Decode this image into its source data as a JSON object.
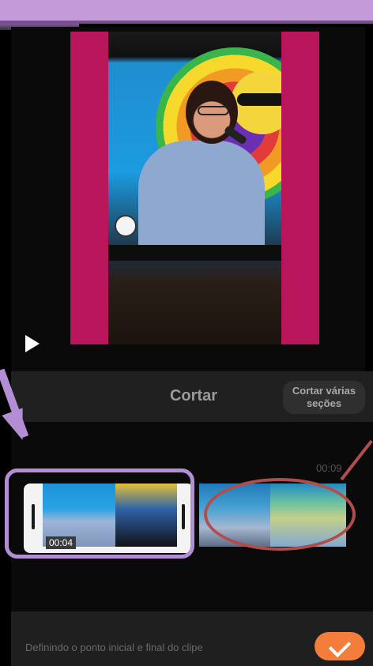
{
  "editor": {
    "title": "Cortar",
    "multi_button": "Cortar várias seções",
    "timeline": {
      "duration": "00:09",
      "selection_time": "00:04"
    },
    "hint": "Definindo o ponto inicial e final do clipe"
  },
  "colors": {
    "accent": "#f47d3b",
    "annotation_purple": "#b48ed4",
    "annotation_red": "#b24d4d",
    "pillar_magenta": "#b8155a"
  }
}
